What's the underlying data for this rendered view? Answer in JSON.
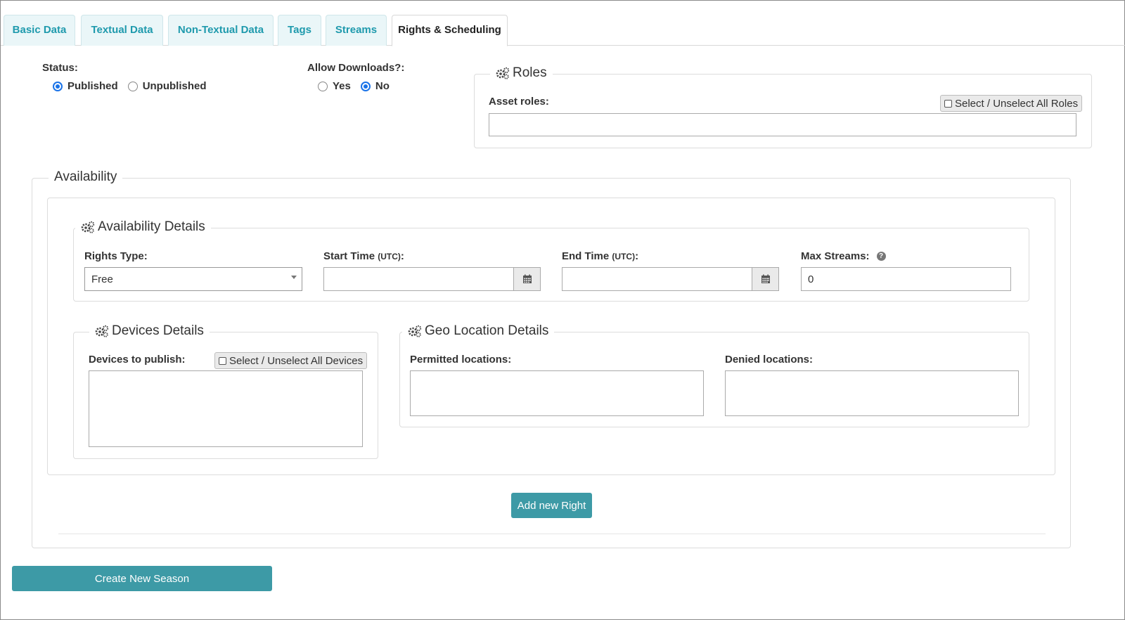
{
  "tabs": [
    {
      "label": "Basic Data"
    },
    {
      "label": "Textual Data"
    },
    {
      "label": "Non-Textual Data"
    },
    {
      "label": "Tags"
    },
    {
      "label": "Streams"
    },
    {
      "label": "Rights & Scheduling"
    }
  ],
  "active_tab": "Rights & Scheduling",
  "status": {
    "label": "Status:",
    "options": [
      "Published",
      "Unpublished"
    ],
    "selected": "Published"
  },
  "downloads": {
    "label": "Allow Downloads?:",
    "options": [
      "Yes",
      "No"
    ],
    "selected": "No"
  },
  "roles": {
    "legend": "Roles",
    "asset_roles_label": "Asset roles:",
    "select_all_label": "Select / Unselect All Roles",
    "value": ""
  },
  "availability": {
    "legend": "Availability",
    "details": {
      "legend": "Availability Details",
      "rights_type": {
        "label": "Rights Type:",
        "value": "Free"
      },
      "start_time": {
        "label": "Start Time",
        "unit": "(UTC)",
        "colon": ":",
        "value": ""
      },
      "end_time": {
        "label": "End Time",
        "unit": "(UTC)",
        "colon": ":",
        "value": ""
      },
      "max_streams": {
        "label": "Max Streams:",
        "value": "0"
      }
    },
    "devices": {
      "legend": "Devices Details",
      "label": "Devices to publish:",
      "select_all_label": "Select / Unselect All Devices"
    },
    "geo": {
      "legend": "Geo Location Details",
      "permitted_label": "Permitted locations:",
      "denied_label": "Denied locations:"
    },
    "add_right_label": "Add new Right"
  },
  "create_season_label": "Create New Season",
  "colors": {
    "accent": "#3d9aa6",
    "tab_text": "#1f9aad",
    "radio": "#1a73e8"
  }
}
